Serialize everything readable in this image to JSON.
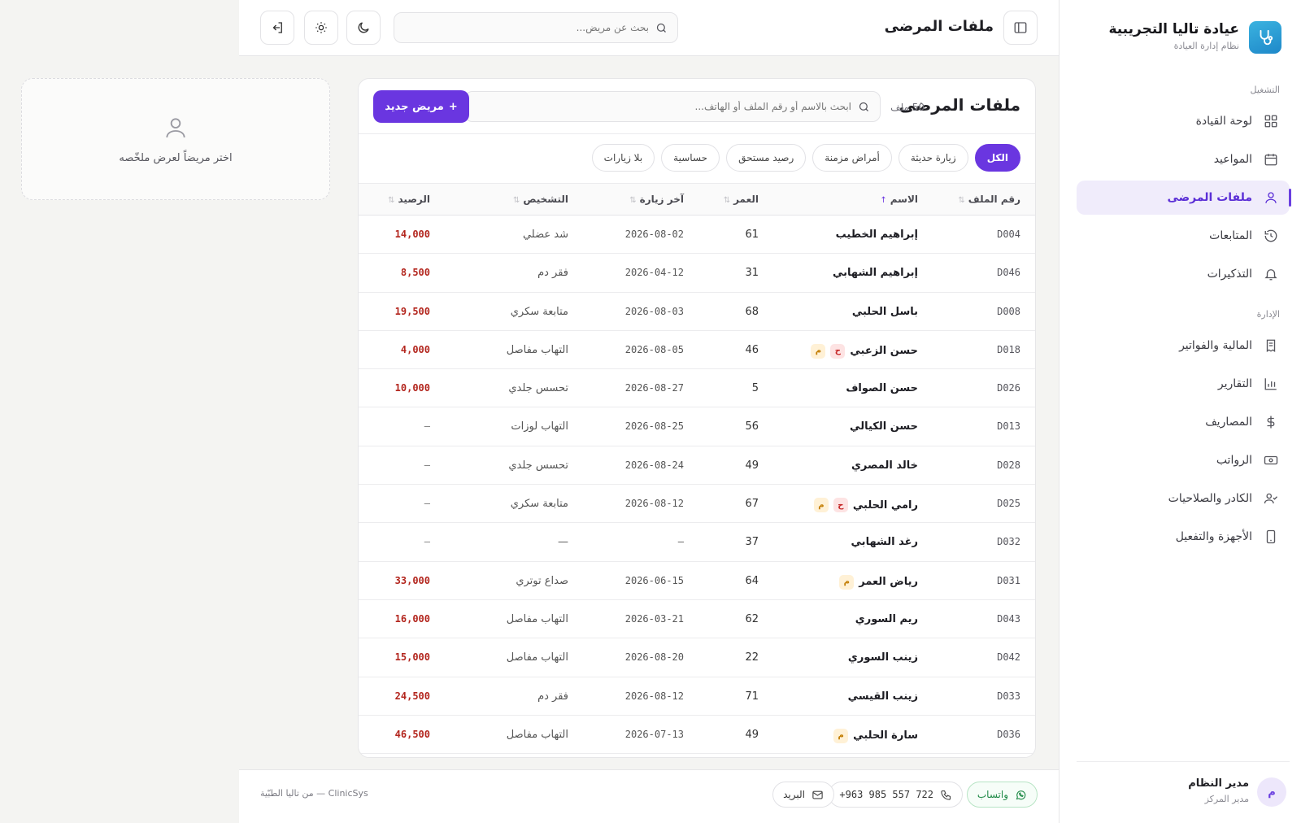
{
  "brand": {
    "title": "عيادة تاليا التجريبية",
    "subtitle": "نظام إدارة العيادة"
  },
  "sidebar": {
    "section_ops": "التشغيل",
    "section_admin": "الإدارة",
    "items": [
      {
        "label": "لوحة القيادة",
        "icon": "grid-icon"
      },
      {
        "label": "المواعيد",
        "icon": "calendar-icon"
      },
      {
        "label": "ملفات المرضى",
        "icon": "user-icon",
        "active": true
      },
      {
        "label": "المتابعات",
        "icon": "history-icon"
      },
      {
        "label": "التذكيرات",
        "icon": "bell-icon"
      },
      {
        "label": "المالية والفواتير",
        "icon": "receipt-icon"
      },
      {
        "label": "التقارير",
        "icon": "bar-chart-icon"
      },
      {
        "label": "المصاريف",
        "icon": "dollar-icon"
      },
      {
        "label": "الرواتب",
        "icon": "banknote-icon"
      },
      {
        "label": "الكادر والصلاحيات",
        "icon": "users-icon"
      },
      {
        "label": "الأجهزة والتفعيل",
        "icon": "phone-icon"
      }
    ],
    "user": {
      "initial": "م",
      "name": "مدير النظام",
      "role": "مدير المركز"
    }
  },
  "topbar": {
    "title": "ملفات المرضى",
    "search_placeholder": "بحث عن مريض..."
  },
  "list": {
    "title": "ملفات المرضى",
    "count": "50 ملف",
    "search_placeholder": "ابحث بالاسم أو رقم الملف أو الهاتف...",
    "new_button": "مريض جديد",
    "filters": [
      "الكل",
      "زيارة حديثة",
      "أمراض مزمنة",
      "رصيد مستحق",
      "حساسية",
      "بلا زيارات"
    ],
    "columns": {
      "id": "رقم الملف",
      "name": "الاسم",
      "age": "العمر",
      "last_visit": "آخر زيارة",
      "diagnosis": "التشخيص",
      "balance": "الرصيد"
    },
    "rows": [
      {
        "id": "D004",
        "name": "إبراهيم الخطيب",
        "tags": [],
        "age": "61",
        "last_visit": "2026-08-02",
        "diagnosis": "شد عضلي",
        "balance": "14,000"
      },
      {
        "id": "D046",
        "name": "إبراهيم الشهابي",
        "tags": [],
        "age": "31",
        "last_visit": "2026-04-12",
        "diagnosis": "فقر دم",
        "balance": "8,500"
      },
      {
        "id": "D008",
        "name": "باسل الحلبي",
        "tags": [],
        "age": "68",
        "last_visit": "2026-08-03",
        "diagnosis": "متابعة سكري",
        "balance": "19,500"
      },
      {
        "id": "D018",
        "name": "حسن الزعبي",
        "tags": [
          "ح",
          "م"
        ],
        "age": "46",
        "last_visit": "2026-08-05",
        "diagnosis": "التهاب مفاصل",
        "balance": "4,000"
      },
      {
        "id": "D026",
        "name": "حسن الصواف",
        "tags": [],
        "age": "5",
        "last_visit": "2026-08-27",
        "diagnosis": "تحسس جلدي",
        "balance": "10,000"
      },
      {
        "id": "D013",
        "name": "حسن الكيالي",
        "tags": [],
        "age": "56",
        "last_visit": "2026-08-25",
        "diagnosis": "التهاب لوزات",
        "balance": "—"
      },
      {
        "id": "D028",
        "name": "خالد المصري",
        "tags": [],
        "age": "49",
        "last_visit": "2026-08-24",
        "diagnosis": "تحسس جلدي",
        "balance": "—"
      },
      {
        "id": "D025",
        "name": "رامي الحلبي",
        "tags": [
          "ح",
          "م"
        ],
        "age": "67",
        "last_visit": "2026-08-12",
        "diagnosis": "متابعة سكري",
        "balance": "—"
      },
      {
        "id": "D032",
        "name": "رغد الشهابي",
        "tags": [],
        "age": "37",
        "last_visit": "—",
        "diagnosis": "—",
        "balance": "—"
      },
      {
        "id": "D031",
        "name": "رياض العمر",
        "tags": [
          "م"
        ],
        "age": "64",
        "last_visit": "2026-06-15",
        "diagnosis": "صداع توتري",
        "balance": "33,000"
      },
      {
        "id": "D043",
        "name": "ريم السوري",
        "tags": [],
        "age": "62",
        "last_visit": "2026-03-21",
        "diagnosis": "التهاب مفاصل",
        "balance": "16,000"
      },
      {
        "id": "D042",
        "name": "زينب السوري",
        "tags": [],
        "age": "22",
        "last_visit": "2026-08-20",
        "diagnosis": "التهاب مفاصل",
        "balance": "15,000"
      },
      {
        "id": "D033",
        "name": "زينب القيسي",
        "tags": [],
        "age": "71",
        "last_visit": "2026-08-12",
        "diagnosis": "فقر دم",
        "balance": "24,500"
      },
      {
        "id": "D036",
        "name": "سارة الحلبي",
        "tags": [
          "م"
        ],
        "age": "49",
        "last_visit": "2026-07-13",
        "diagnosis": "التهاب مفاصل",
        "balance": "46,500"
      }
    ]
  },
  "summary": {
    "empty_text": "اختر مريضاً لعرض ملخّصه"
  },
  "footer": {
    "whatsapp": "واتساب",
    "phone": "+963 985 557 722",
    "email": "البريد",
    "credit": "ClinicSys — من تاليا الطبّية"
  },
  "colors": {
    "accent": "#6a36e0",
    "balance_due": "#b3261e",
    "whatsapp": "#1f8a47"
  }
}
